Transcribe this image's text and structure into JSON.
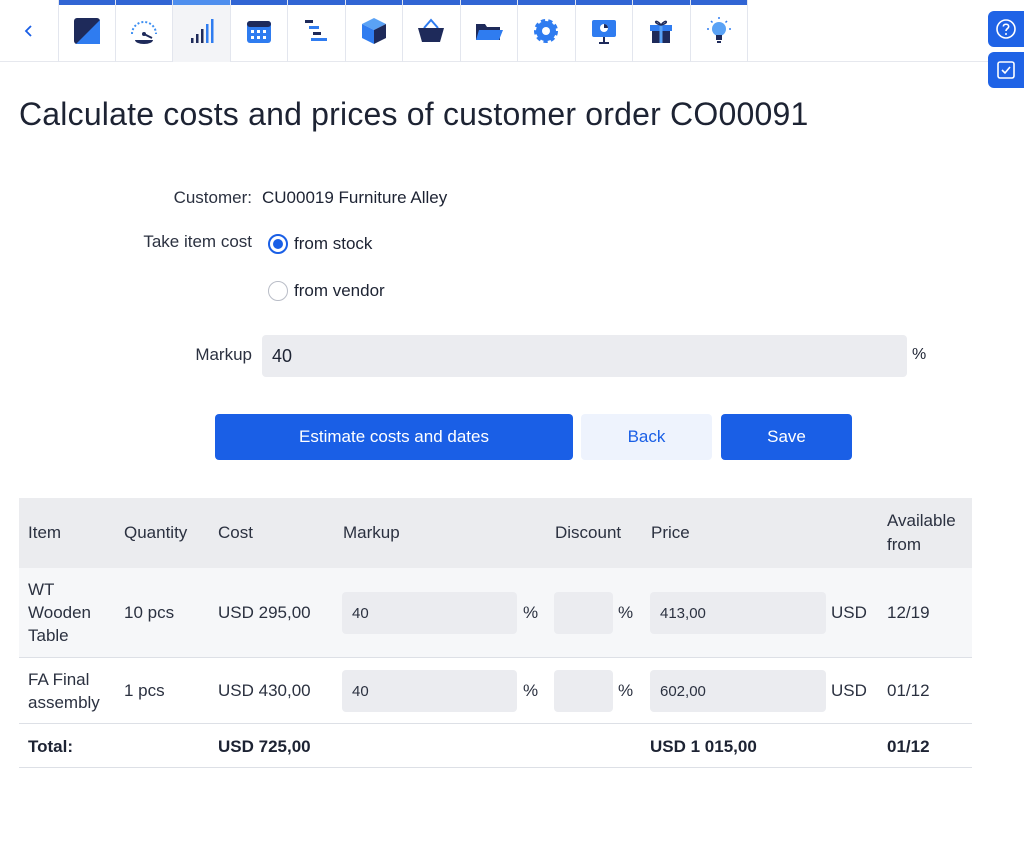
{
  "toolbar": {
    "back_icon": "chevron-left-icon",
    "tabs": [
      {
        "icon": "dashboard-logo-icon"
      },
      {
        "icon": "speedometer-icon"
      },
      {
        "icon": "bar-chart-icon"
      },
      {
        "icon": "calendar-icon"
      },
      {
        "icon": "gantt-icon"
      },
      {
        "icon": "box-icon"
      },
      {
        "icon": "basket-icon"
      },
      {
        "icon": "folder-icon"
      },
      {
        "icon": "gear-icon"
      },
      {
        "icon": "presentation-icon"
      },
      {
        "icon": "gift-icon"
      },
      {
        "icon": "lightbulb-icon"
      }
    ],
    "help_icon": "help-icon",
    "tasks_icon": "checkbox-icon"
  },
  "page": {
    "title": "Calculate costs and prices of customer order CO00091"
  },
  "form": {
    "customer_label": "Customer:",
    "customer_value": "CU00019 Furniture Alley",
    "item_cost_label": "Take item cost",
    "option_stock": "from stock",
    "option_vendor": "from vendor",
    "selected_option": "from stock",
    "markup_label": "Markup",
    "markup_value": "40",
    "markup_unit": "%"
  },
  "actions": {
    "estimate": "Estimate costs and dates",
    "back": "Back",
    "save": "Save"
  },
  "table": {
    "headers": {
      "item": "Item",
      "quantity": "Quantity",
      "cost": "Cost",
      "markup": "Markup",
      "discount": "Discount",
      "price": "Price",
      "available_line1": "Available",
      "available_line2": "from"
    },
    "rows": [
      {
        "item_lines": [
          "WT",
          "Wooden",
          "Table"
        ],
        "quantity": "10 pcs",
        "cost": "USD 295,00",
        "markup": "40",
        "markup_unit": "%",
        "discount": "",
        "discount_unit": "%",
        "price": "413,00",
        "price_currency": "USD",
        "available": "12/19"
      },
      {
        "item_lines": [
          "FA Final",
          "assembly"
        ],
        "quantity": "1 pcs",
        "cost": "USD 430,00",
        "markup": "40",
        "markup_unit": "%",
        "discount": "",
        "discount_unit": "%",
        "price": "602,00",
        "price_currency": "USD",
        "available": "01/12"
      }
    ],
    "total": {
      "label": "Total:",
      "cost": "USD 725,00",
      "price": "USD 1 015,00",
      "available": "01/12"
    }
  }
}
